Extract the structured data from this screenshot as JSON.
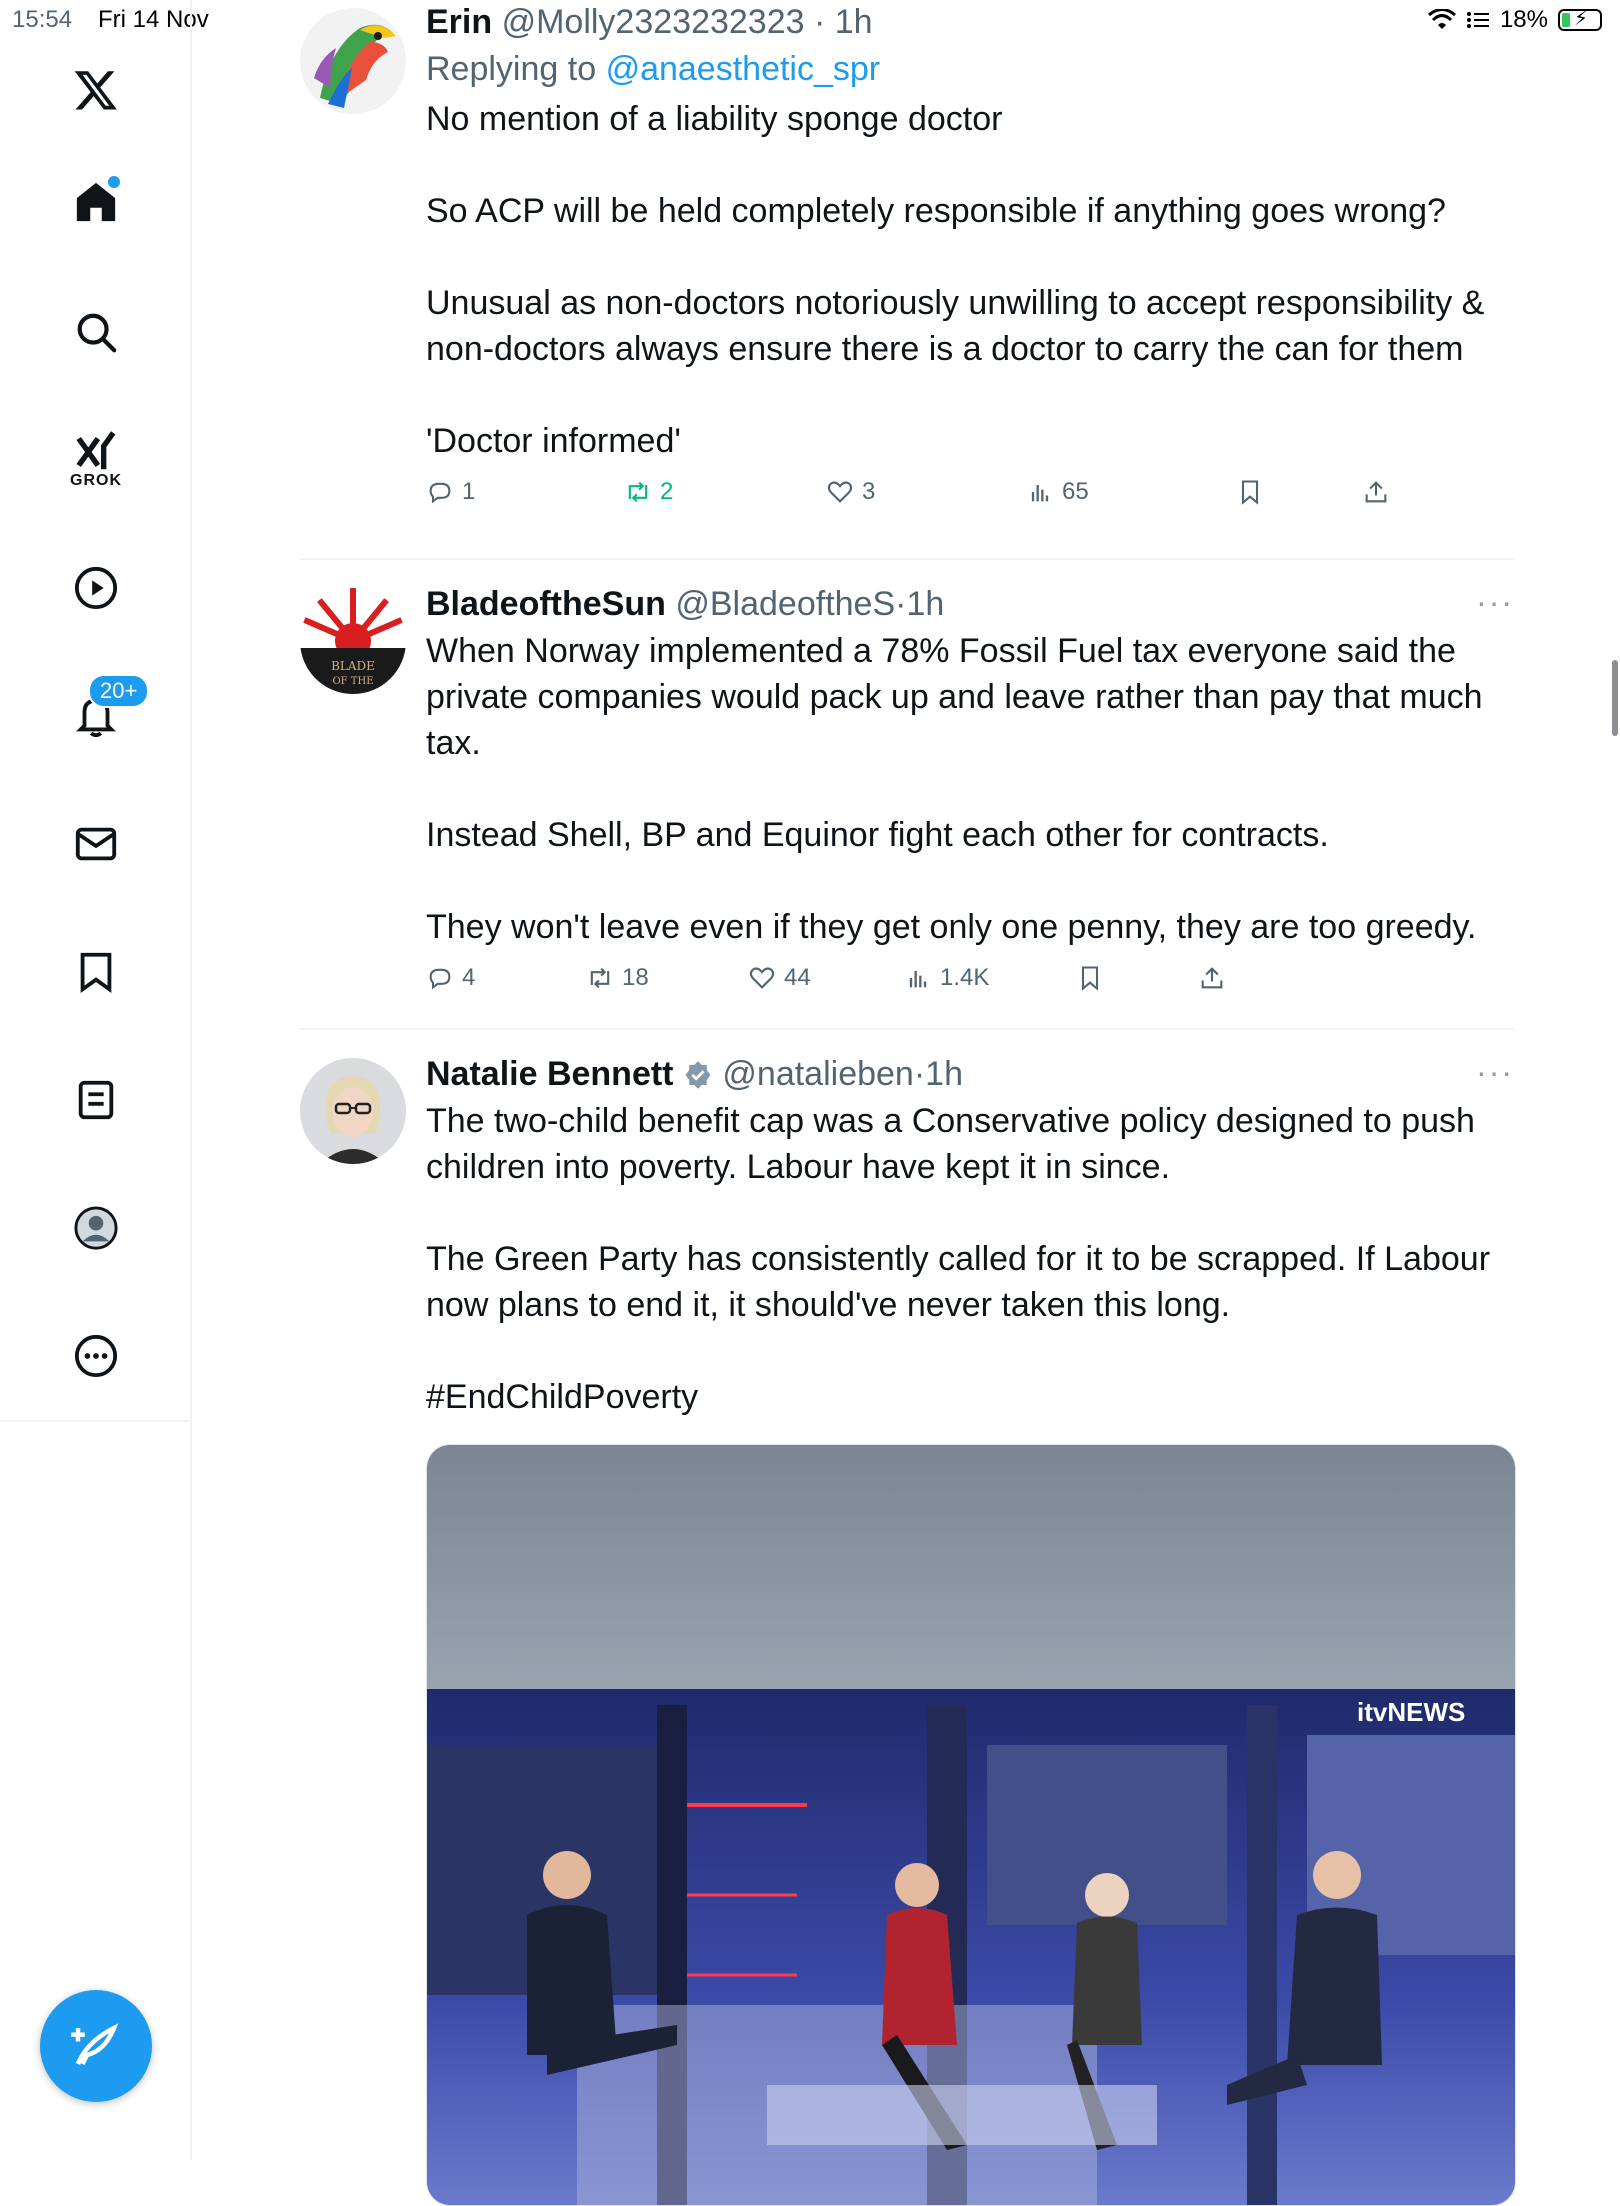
{
  "status_bar": {
    "time": "15:54",
    "date": "Fri 14 Nov",
    "battery": "18%"
  },
  "sidebar": {
    "grok_label": "GROK",
    "notifications_badge": "20+",
    "icons": [
      "x-logo-icon",
      "home-icon",
      "search-icon",
      "grok-icon",
      "video-icon",
      "bell-icon",
      "mail-icon",
      "bookmark-icon",
      "lists-icon",
      "profile-icon",
      "more-icon",
      "compose-icon"
    ]
  },
  "tweets": [
    {
      "name": "Erin",
      "handle": "@Molly2323232323",
      "time": "1h",
      "reply_prefix": "Replying to",
      "reply_to": "@anaesthetic_spr",
      "paragraphs": [
        [
          "No mention of a liability sponge doctor"
        ],
        [
          "So ACP will be held completely responsible if anything goes wrong?"
        ],
        [
          "Unusual as non-doctors notoriously unwilling to accept  responsibility &",
          "non-doctors always ensure  there is a doctor to carry the can for them"
        ],
        [
          "'Doctor informed'"
        ]
      ],
      "replies": "1",
      "reposts": "2",
      "likes": "3",
      "views": "65"
    },
    {
      "name": "BladeoftheSun",
      "handle": "@BladeoftheS",
      "time": "1h",
      "more": "···",
      "paragraphs": [
        [
          "When Norway implemented a 78% Fossil Fuel tax everyone said the",
          "private companies would pack up and leave rather than pay that much",
          "tax."
        ],
        [
          "Instead Shell, BP and Equinor fight each other for contracts."
        ],
        [
          "They won't leave even if they get only one penny, they are too greedy."
        ]
      ],
      "replies": "4",
      "reposts": "18",
      "likes": "44",
      "views": "1.4K"
    },
    {
      "name": "Natalie Bennett",
      "handle": "@natalieben",
      "time": "1h",
      "more": "···",
      "paragraphs": [
        [
          "The two-child benefit cap was a Conservative policy designed to push",
          "children into poverty. Labour have kept it in since."
        ],
        [
          "The Green Party has consistently called for it to be scrapped. If Labour",
          "now plans to end it, it should've never taken this long."
        ]
      ],
      "hashtag": "#EndChildPoverty",
      "media_watermark": "itvNEWS"
    }
  ],
  "colors": {
    "accent": "#1d9bf0",
    "repost_active": "#00ba7c",
    "secondary_text": "#536471"
  }
}
